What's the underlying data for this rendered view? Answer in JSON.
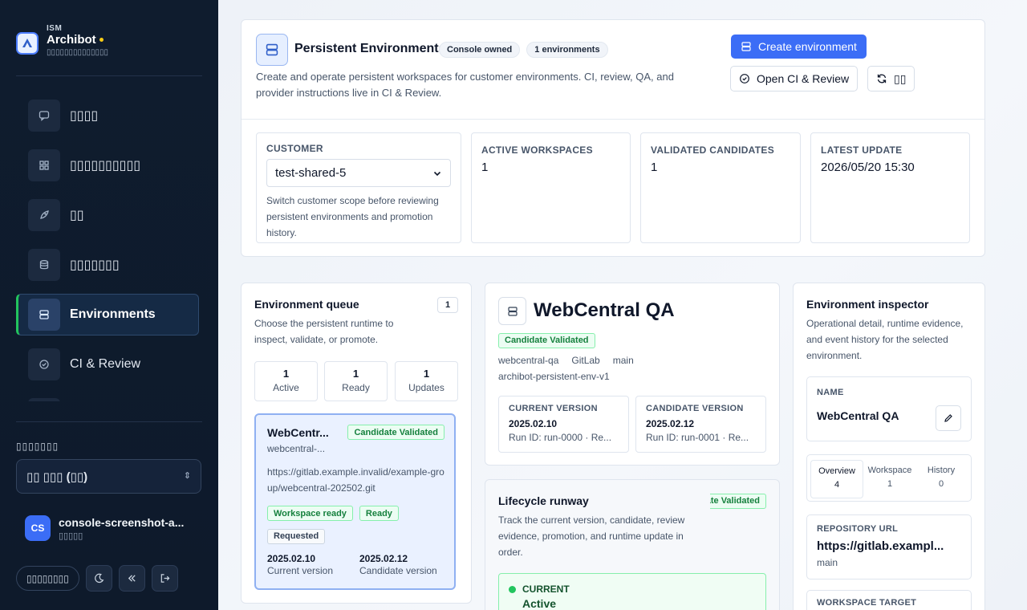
{
  "sidebar": {
    "brand_small": "ISM",
    "brand_name": "Archibot",
    "brand_sub": "▯▯▯▯▯▯▯▯▯▯▯▯▯▯",
    "nav": [
      {
        "label": "▯▯▯▯",
        "icon": "chat-icon"
      },
      {
        "label": "▯▯▯▯▯▯▯▯▯▯",
        "icon": "grid-icon"
      },
      {
        "label": "▯▯",
        "icon": "rocket-icon"
      },
      {
        "label": "▯▯▯▯▯▯▯",
        "icon": "database-icon"
      },
      {
        "label": "Environments",
        "icon": "server-icon"
      },
      {
        "label": "CI & Review",
        "icon": "check-circle-icon"
      }
    ],
    "lang_label": "▯▯▯▯▯▯▯",
    "lang_value": "▯▯ ▯▯▯ (▯▯)",
    "user_initials": "CS",
    "user_name": "console-screenshot-a...",
    "user_role": "▯▯▯▯▯",
    "footer_pill": "▯▯▯▯▯▯▯▯"
  },
  "header": {
    "title": "Persistent Environments",
    "chip_owner": "Console owned",
    "chip_count": "1 environments",
    "description": "Create and operate persistent workspaces for customer environments. CI, review, QA, and provider instructions live in CI & Review.",
    "create_button": "Create environment",
    "ci_button": "Open CI & Review",
    "refresh_button": "▯▯"
  },
  "stats": {
    "customer_label": "CUSTOMER",
    "customer_value": "test-shared-5",
    "customer_help": "Switch customer scope before reviewing persistent environments and promotion history.",
    "active_label": "ACTIVE WORKSPACES",
    "active_value": "1",
    "validated_label": "VALIDATED CANDIDATES",
    "validated_value": "1",
    "latest_label": "LATEST UPDATE",
    "latest_value": "2026/05/20 15:30"
  },
  "queue": {
    "title": "Environment queue",
    "count": "1",
    "description": "Choose the persistent runtime to inspect, validate, or promote.",
    "stats": [
      {
        "n": "1",
        "label": "Active"
      },
      {
        "n": "1",
        "label": "Ready"
      },
      {
        "n": "1",
        "label": "Updates"
      }
    ],
    "card": {
      "name": "WebCentr...",
      "badge": "Candidate Validated",
      "slug": "webcentral-...",
      "repo": "https://gitlab.example.invalid/example-group/webcentral-202502.git",
      "tags": [
        "Workspace ready",
        "Ready"
      ],
      "requested": "Requested",
      "current_version": "2025.02.10",
      "current_label": "Current version",
      "candidate_version": "2025.02.12",
      "candidate_label": "Candidate version"
    }
  },
  "detail": {
    "title": "WebCentral QA",
    "badge": "Candidate Validated",
    "meta": [
      "webcentral-qa",
      "GitLab",
      "main"
    ],
    "template": "archibot-persistent-env-v1",
    "current_label": "CURRENT VERSION",
    "current_value": "2025.02.10",
    "current_run": "Run ID: run-0000 · Re...",
    "candidate_label": "CANDIDATE VERSION",
    "candidate_value": "2025.02.12",
    "candidate_run": "Run ID: run-0001 · Re..."
  },
  "runway": {
    "title": "Lifecycle runway",
    "badge": "Candidate Validated",
    "description": "Track the current version, candidate, review evidence, promotion, and runtime update in order.",
    "step_label": "CURRENT",
    "step_value": "Active"
  },
  "inspector": {
    "title": "Environment inspector",
    "description": "Operational detail, runtime evidence, and event history for the selected environment.",
    "name_label": "NAME",
    "name_value": "WebCentral QA",
    "tabs": [
      {
        "label": "Overview",
        "count": "4"
      },
      {
        "label": "Workspace",
        "count": "1"
      },
      {
        "label": "History",
        "count": "0"
      }
    ],
    "repo_label": "REPOSITORY URL",
    "repo_value": "https://gitlab.exampl...",
    "repo_branch": "main",
    "target_label": "WORKSPACE TARGET"
  },
  "colors": {
    "accent": "#3b6df6",
    "success": "#15803d",
    "sidebar": "#0f1c2e"
  }
}
